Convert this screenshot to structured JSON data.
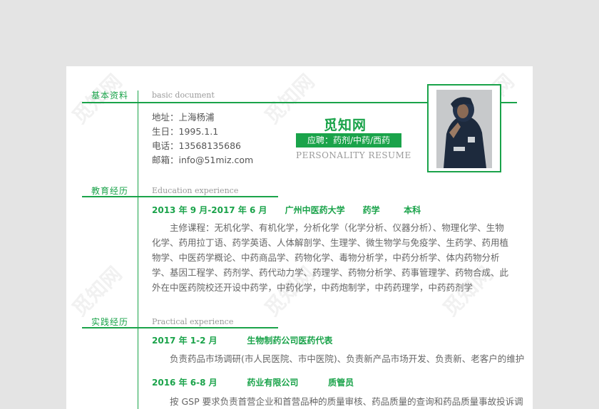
{
  "watermark": "觅知网",
  "sections": {
    "basic": {
      "title": "基本资料",
      "en": "basic document"
    },
    "education": {
      "title": "教育经历",
      "en": "Education experience"
    },
    "practice": {
      "title": "实践经历",
      "en": "Practical experience"
    }
  },
  "info": {
    "address": "地址：上海杨浦",
    "birth": "生日：1995.1.1",
    "phone": "电话：13568135686",
    "email": "邮箱：info@51miz.com"
  },
  "header": {
    "name": "觅知网",
    "apply": "应聘：药剂/中药/西药",
    "subtitle": "PERSONALITY RESUME"
  },
  "education": {
    "head": "2013 年 9 月-2017 年 6 月      广州中医药大学      药学        本科",
    "course": "主修课程：无机化学、有机化学，分析化学（化学分析、仪器分析）、物理化学、生物化学、药用拉丁语、药学英语、人体解剖学、生理学、微生物学与免疫学、生药学、药用植物学、中医药学概论、中药商品学、药物化学、毒物分析学，中药分析学、体内药物分析学、基因工程学、药剂学、药代动力学、药理学、药物分析学、药事管理学、药物合成、此外在中医药院校还开设中药学，中药化学，中药炮制学，中药药理学，中药药剂学"
  },
  "practice": [
    {
      "head": "2017 年 1-2 月          生物制药公司医药代表",
      "desc": "负责药品市场调研(市人民医院、市中医院)、负责新产品市场开发、负责新、老客户的维护"
    },
    {
      "head": "2016 年 6-8 月          药业有限公司          质管员",
      "desc": "按 GSP 要求负责首营企业和首营品种的质量审核、药品质量的查询和药品质量事故投诉调"
    }
  ]
}
